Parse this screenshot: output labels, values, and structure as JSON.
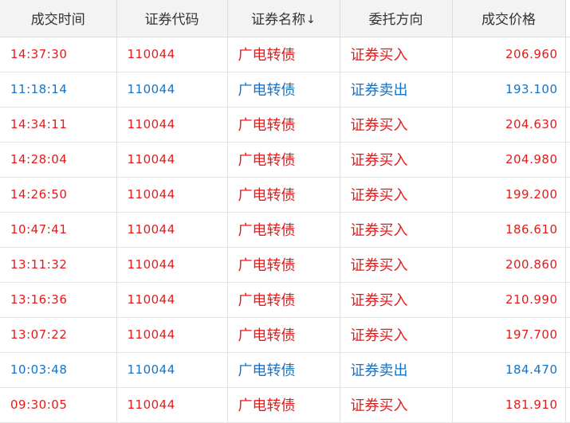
{
  "table": {
    "headers": {
      "time": "成交时间",
      "code": "证券代码",
      "name": "证券名称",
      "side": "委托方向",
      "price": "成交价格",
      "sort_glyph": "↓"
    },
    "colors": {
      "buy": "#e61919",
      "sell": "#1473c8",
      "header_bg": "#f3f3f3"
    },
    "rows": [
      {
        "side_type": "buy",
        "time": "14:37:30",
        "code": "110044",
        "name": "广电转债",
        "side": "证券买入",
        "price": "206.960"
      },
      {
        "side_type": "sell",
        "time": "11:18:14",
        "code": "110044",
        "name": "广电转债",
        "side": "证券卖出",
        "price": "193.100"
      },
      {
        "side_type": "buy",
        "time": "14:34:11",
        "code": "110044",
        "name": "广电转债",
        "side": "证券买入",
        "price": "204.630"
      },
      {
        "side_type": "buy",
        "time": "14:28:04",
        "code": "110044",
        "name": "广电转债",
        "side": "证券买入",
        "price": "204.980"
      },
      {
        "side_type": "buy",
        "time": "14:26:50",
        "code": "110044",
        "name": "广电转债",
        "side": "证券买入",
        "price": "199.200"
      },
      {
        "side_type": "buy",
        "time": "10:47:41",
        "code": "110044",
        "name": "广电转债",
        "side": "证券买入",
        "price": "186.610"
      },
      {
        "side_type": "buy",
        "time": "13:11:32",
        "code": "110044",
        "name": "广电转债",
        "side": "证券买入",
        "price": "200.860"
      },
      {
        "side_type": "buy",
        "time": "13:16:36",
        "code": "110044",
        "name": "广电转债",
        "side": "证券买入",
        "price": "210.990"
      },
      {
        "side_type": "buy",
        "time": "13:07:22",
        "code": "110044",
        "name": "广电转债",
        "side": "证券买入",
        "price": "197.700"
      },
      {
        "side_type": "sell",
        "time": "10:03:48",
        "code": "110044",
        "name": "广电转债",
        "side": "证券卖出",
        "price": "184.470"
      },
      {
        "side_type": "buy",
        "time": "09:30:05",
        "code": "110044",
        "name": "广电转债",
        "side": "证券买入",
        "price": "181.910"
      }
    ]
  }
}
